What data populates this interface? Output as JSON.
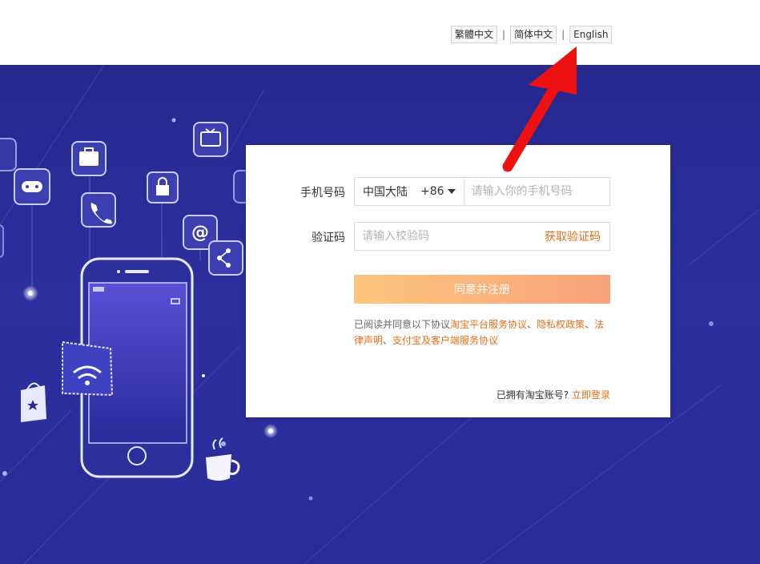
{
  "languages": {
    "traditional": "繁體中文",
    "simplified": "简体中文",
    "english": "English",
    "separator": "|"
  },
  "form": {
    "phone_label": "手机号码",
    "region": "中国大陆",
    "region_code": "+86",
    "phone_placeholder": "请输入你的手机号码",
    "code_label": "验证码",
    "code_placeholder": "请输入校验码",
    "get_code": "获取验证码",
    "submit": "同意并注册",
    "agreement_prefix": "已阅读并同意以下协议",
    "agreement_links": [
      "淘宝平台服务协议",
      "隐私权政策",
      "法律声明",
      "支付宝及客户端服务协议"
    ],
    "agreement_sep": "、",
    "has_account": "已拥有淘宝账号?",
    "login_link": "立即登录"
  },
  "icons": [
    "tv-icon",
    "gamepad-icon",
    "suitcase-icon",
    "phone-icon",
    "lock-icon",
    "at-icon",
    "share-icon",
    "wifi-icon",
    "shopping-bag-icon",
    "coffee-cup-icon",
    "smartphone-icon"
  ],
  "colors": {
    "hero_bg": "#2a2d98",
    "accent": "#e86c1a",
    "button_gradient_start": "#fcc67e",
    "button_gradient_end": "#f9a27a",
    "annotation_arrow": "#ee1111"
  }
}
